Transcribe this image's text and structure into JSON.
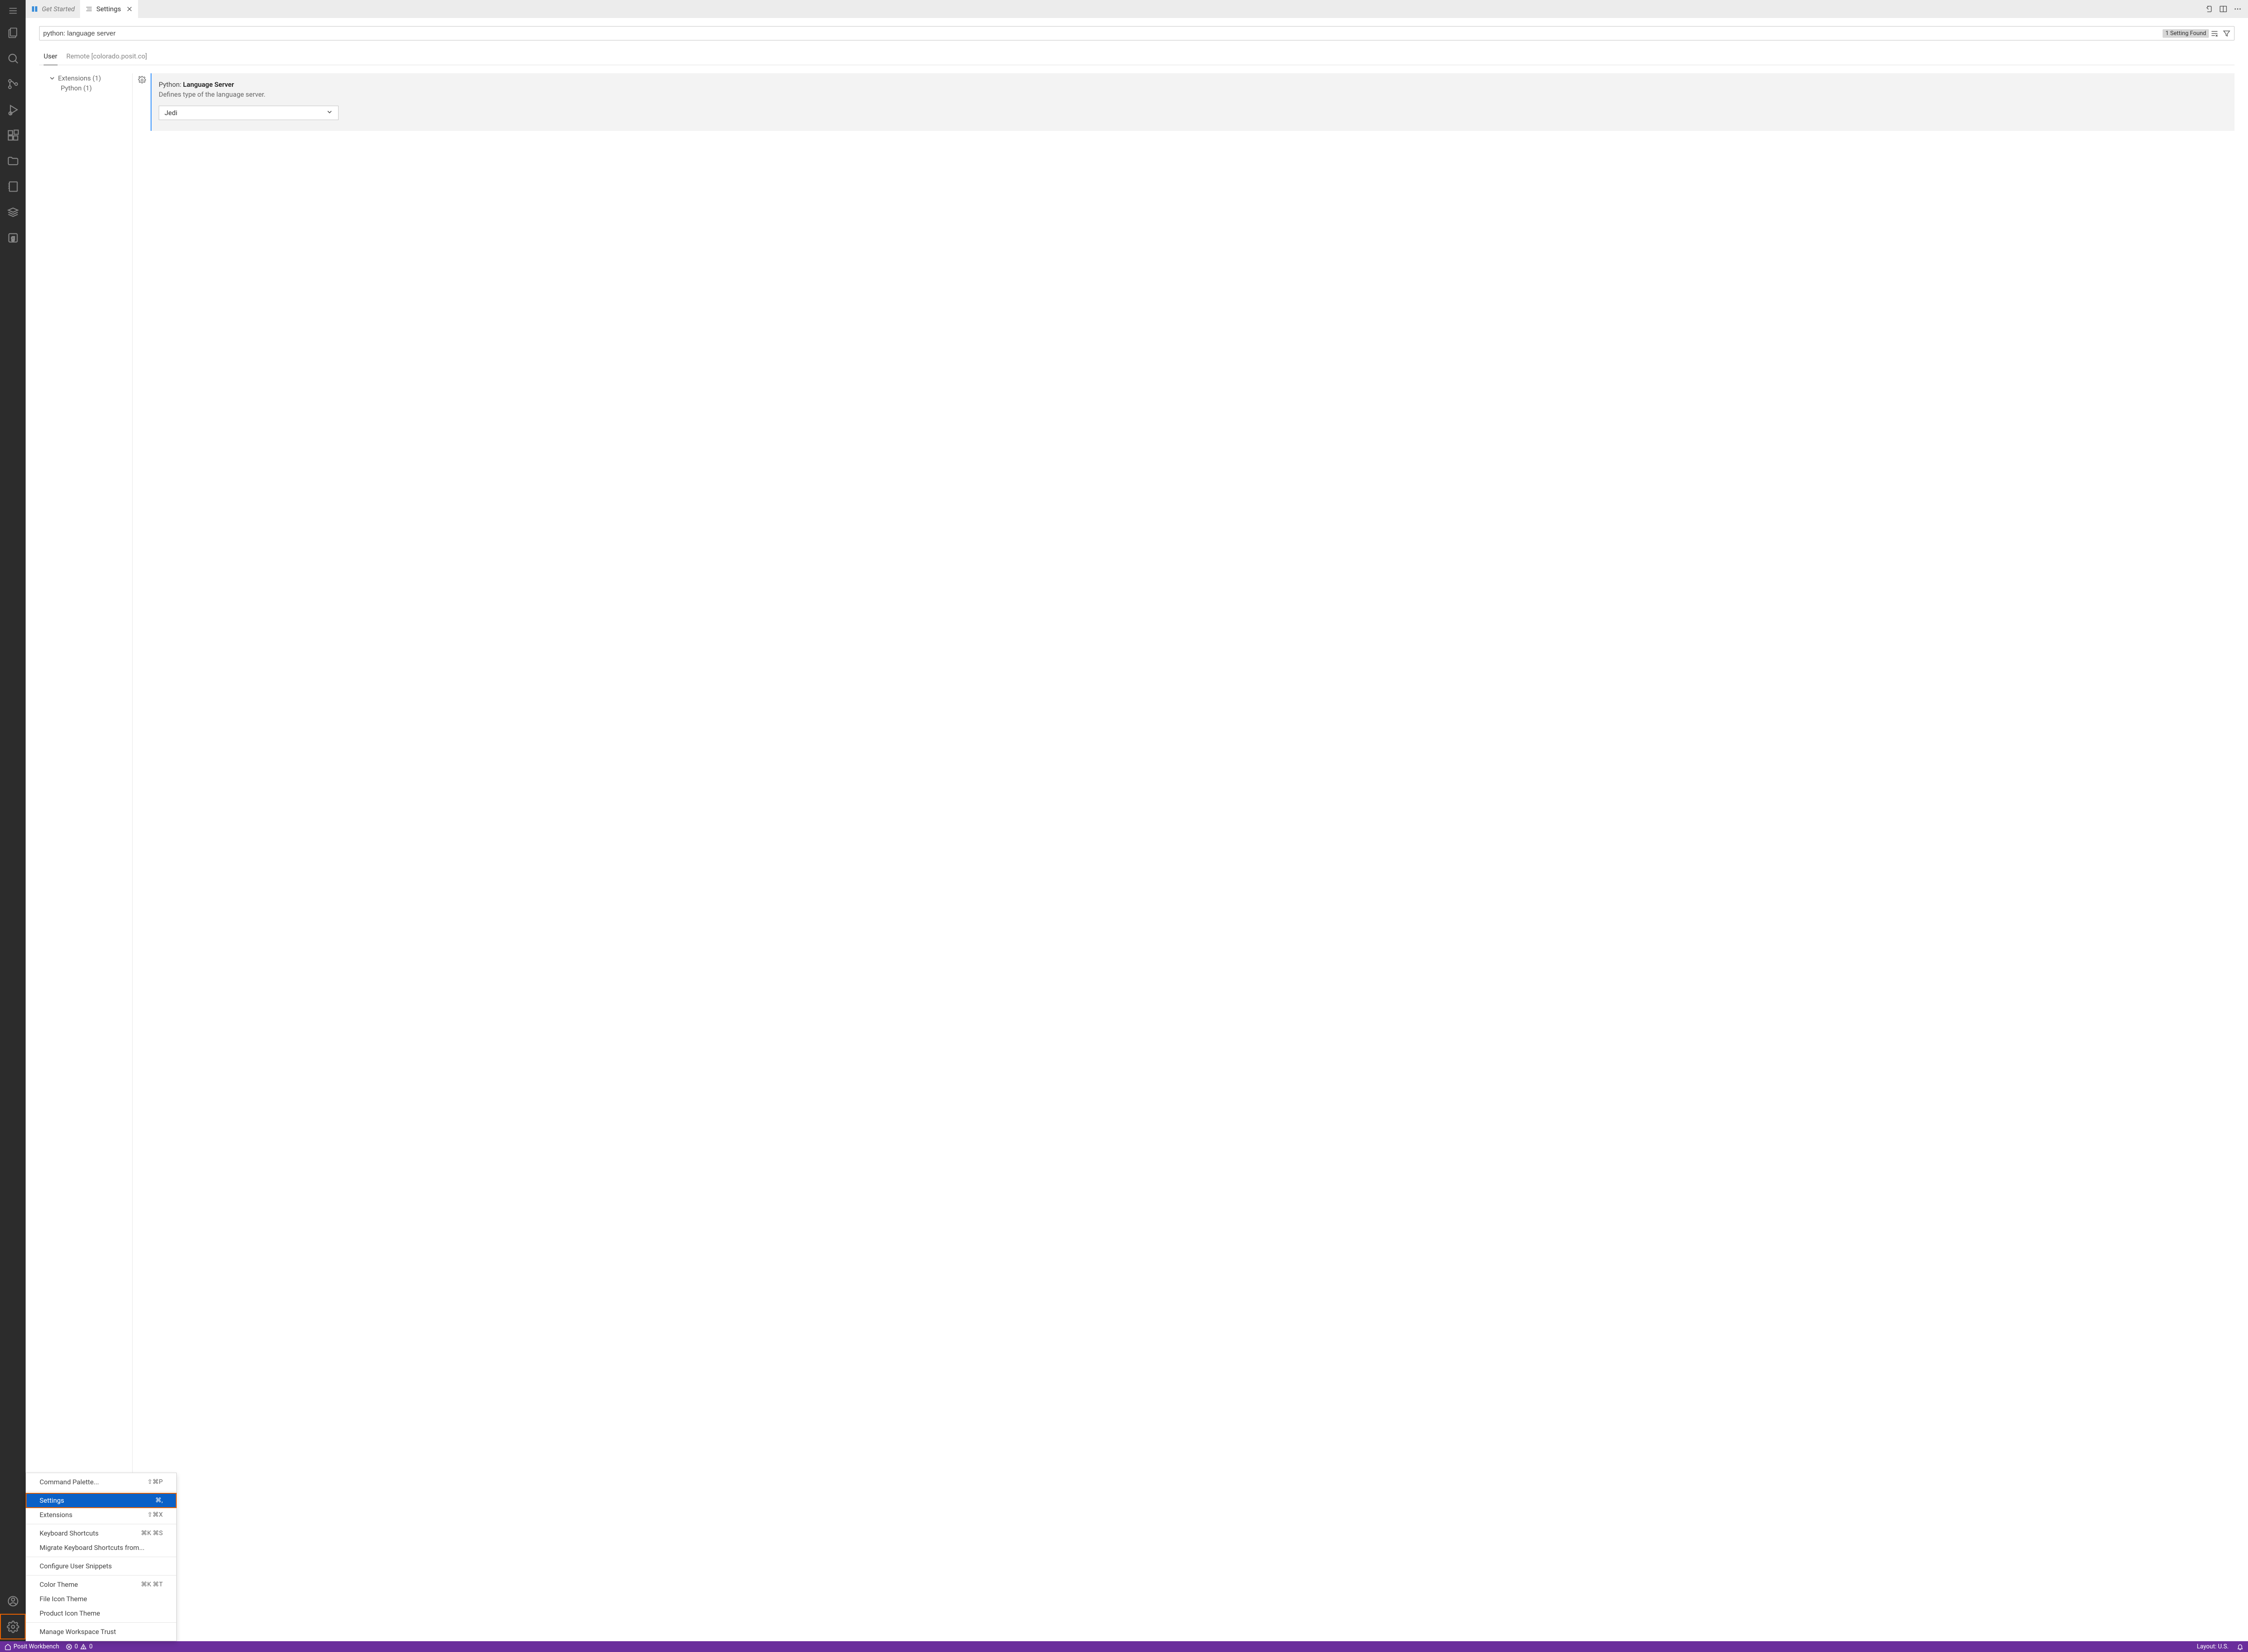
{
  "tabs": {
    "getStarted": "Get Started",
    "settings": "Settings"
  },
  "search": {
    "value": "python: language server",
    "resultsBadge": "1 Setting Found"
  },
  "scope": {
    "user": "User",
    "remote": "Remote [colorado.posit.co]"
  },
  "tree": {
    "extensions": "Extensions (1)",
    "python": "Python (1)"
  },
  "setting": {
    "prefix": "Python: ",
    "name": "Language Server",
    "desc": "Defines type of the language server.",
    "value": "Jedi"
  },
  "menu": {
    "commandPalette": "Command Palette...",
    "commandPaletteShort": "⇧⌘P",
    "settings": "Settings",
    "settingsShort": "⌘,",
    "extensions": "Extensions",
    "extensionsShort": "⇧⌘X",
    "keyboardShortcuts": "Keyboard Shortcuts",
    "keyboardShortcutsShort": "⌘K ⌘S",
    "migrate": "Migrate Keyboard Shortcuts from...",
    "snippets": "Configure User Snippets",
    "colorTheme": "Color Theme",
    "colorThemeShort": "⌘K ⌘T",
    "fileIconTheme": "File Icon Theme",
    "productIconTheme": "Product Icon Theme",
    "workspaceTrust": "Manage Workspace Trust"
  },
  "status": {
    "workbench": "Posit Workbench",
    "errors": "0",
    "warnings": "0",
    "layout": "Layout: U.S."
  }
}
